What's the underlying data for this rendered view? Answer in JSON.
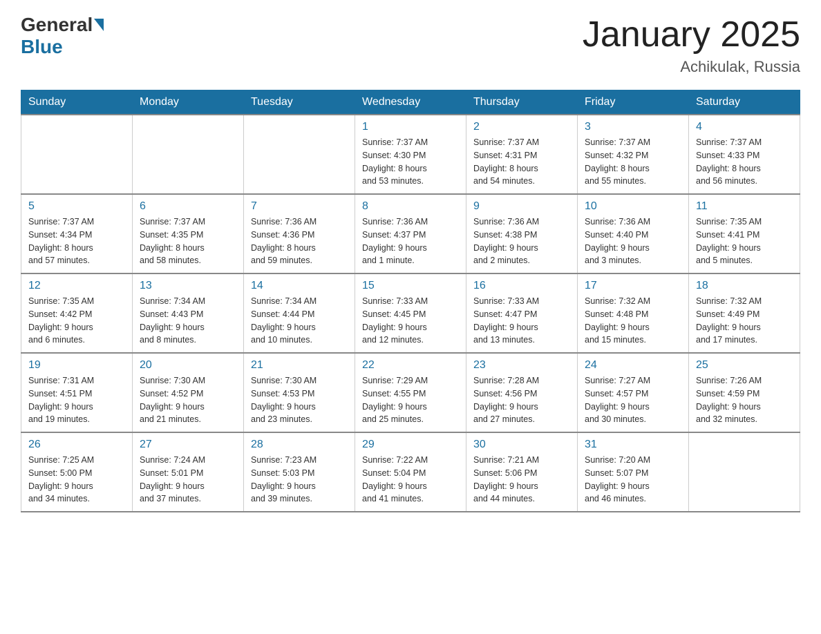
{
  "header": {
    "logo_general": "General",
    "logo_blue": "Blue",
    "month_title": "January 2025",
    "location": "Achikulak, Russia"
  },
  "days_of_week": [
    "Sunday",
    "Monday",
    "Tuesday",
    "Wednesday",
    "Thursday",
    "Friday",
    "Saturday"
  ],
  "weeks": [
    [
      {
        "day": "",
        "info": ""
      },
      {
        "day": "",
        "info": ""
      },
      {
        "day": "",
        "info": ""
      },
      {
        "day": "1",
        "info": "Sunrise: 7:37 AM\nSunset: 4:30 PM\nDaylight: 8 hours\nand 53 minutes."
      },
      {
        "day": "2",
        "info": "Sunrise: 7:37 AM\nSunset: 4:31 PM\nDaylight: 8 hours\nand 54 minutes."
      },
      {
        "day": "3",
        "info": "Sunrise: 7:37 AM\nSunset: 4:32 PM\nDaylight: 8 hours\nand 55 minutes."
      },
      {
        "day": "4",
        "info": "Sunrise: 7:37 AM\nSunset: 4:33 PM\nDaylight: 8 hours\nand 56 minutes."
      }
    ],
    [
      {
        "day": "5",
        "info": "Sunrise: 7:37 AM\nSunset: 4:34 PM\nDaylight: 8 hours\nand 57 minutes."
      },
      {
        "day": "6",
        "info": "Sunrise: 7:37 AM\nSunset: 4:35 PM\nDaylight: 8 hours\nand 58 minutes."
      },
      {
        "day": "7",
        "info": "Sunrise: 7:36 AM\nSunset: 4:36 PM\nDaylight: 8 hours\nand 59 minutes."
      },
      {
        "day": "8",
        "info": "Sunrise: 7:36 AM\nSunset: 4:37 PM\nDaylight: 9 hours\nand 1 minute."
      },
      {
        "day": "9",
        "info": "Sunrise: 7:36 AM\nSunset: 4:38 PM\nDaylight: 9 hours\nand 2 minutes."
      },
      {
        "day": "10",
        "info": "Sunrise: 7:36 AM\nSunset: 4:40 PM\nDaylight: 9 hours\nand 3 minutes."
      },
      {
        "day": "11",
        "info": "Sunrise: 7:35 AM\nSunset: 4:41 PM\nDaylight: 9 hours\nand 5 minutes."
      }
    ],
    [
      {
        "day": "12",
        "info": "Sunrise: 7:35 AM\nSunset: 4:42 PM\nDaylight: 9 hours\nand 6 minutes."
      },
      {
        "day": "13",
        "info": "Sunrise: 7:34 AM\nSunset: 4:43 PM\nDaylight: 9 hours\nand 8 minutes."
      },
      {
        "day": "14",
        "info": "Sunrise: 7:34 AM\nSunset: 4:44 PM\nDaylight: 9 hours\nand 10 minutes."
      },
      {
        "day": "15",
        "info": "Sunrise: 7:33 AM\nSunset: 4:45 PM\nDaylight: 9 hours\nand 12 minutes."
      },
      {
        "day": "16",
        "info": "Sunrise: 7:33 AM\nSunset: 4:47 PM\nDaylight: 9 hours\nand 13 minutes."
      },
      {
        "day": "17",
        "info": "Sunrise: 7:32 AM\nSunset: 4:48 PM\nDaylight: 9 hours\nand 15 minutes."
      },
      {
        "day": "18",
        "info": "Sunrise: 7:32 AM\nSunset: 4:49 PM\nDaylight: 9 hours\nand 17 minutes."
      }
    ],
    [
      {
        "day": "19",
        "info": "Sunrise: 7:31 AM\nSunset: 4:51 PM\nDaylight: 9 hours\nand 19 minutes."
      },
      {
        "day": "20",
        "info": "Sunrise: 7:30 AM\nSunset: 4:52 PM\nDaylight: 9 hours\nand 21 minutes."
      },
      {
        "day": "21",
        "info": "Sunrise: 7:30 AM\nSunset: 4:53 PM\nDaylight: 9 hours\nand 23 minutes."
      },
      {
        "day": "22",
        "info": "Sunrise: 7:29 AM\nSunset: 4:55 PM\nDaylight: 9 hours\nand 25 minutes."
      },
      {
        "day": "23",
        "info": "Sunrise: 7:28 AM\nSunset: 4:56 PM\nDaylight: 9 hours\nand 27 minutes."
      },
      {
        "day": "24",
        "info": "Sunrise: 7:27 AM\nSunset: 4:57 PM\nDaylight: 9 hours\nand 30 minutes."
      },
      {
        "day": "25",
        "info": "Sunrise: 7:26 AM\nSunset: 4:59 PM\nDaylight: 9 hours\nand 32 minutes."
      }
    ],
    [
      {
        "day": "26",
        "info": "Sunrise: 7:25 AM\nSunset: 5:00 PM\nDaylight: 9 hours\nand 34 minutes."
      },
      {
        "day": "27",
        "info": "Sunrise: 7:24 AM\nSunset: 5:01 PM\nDaylight: 9 hours\nand 37 minutes."
      },
      {
        "day": "28",
        "info": "Sunrise: 7:23 AM\nSunset: 5:03 PM\nDaylight: 9 hours\nand 39 minutes."
      },
      {
        "day": "29",
        "info": "Sunrise: 7:22 AM\nSunset: 5:04 PM\nDaylight: 9 hours\nand 41 minutes."
      },
      {
        "day": "30",
        "info": "Sunrise: 7:21 AM\nSunset: 5:06 PM\nDaylight: 9 hours\nand 44 minutes."
      },
      {
        "day": "31",
        "info": "Sunrise: 7:20 AM\nSunset: 5:07 PM\nDaylight: 9 hours\nand 46 minutes."
      },
      {
        "day": "",
        "info": ""
      }
    ]
  ]
}
